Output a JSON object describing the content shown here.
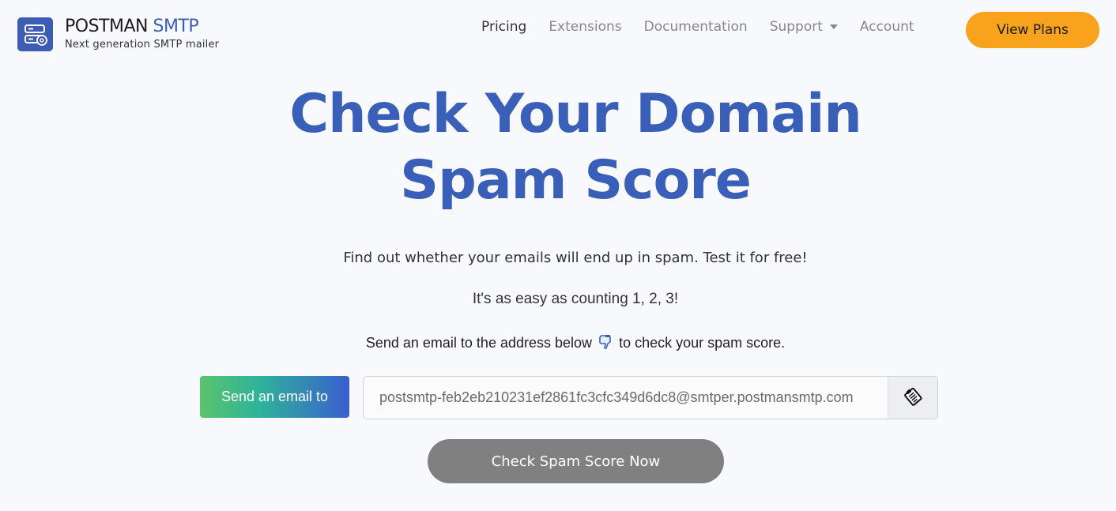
{
  "header": {
    "logo": {
      "title_main": "POSTMAN",
      "title_accent": "SMTP",
      "tagline": "Next generation SMTP mailer",
      "icon": "server-mail-icon"
    },
    "nav": [
      {
        "label": "Pricing",
        "active": true
      },
      {
        "label": "Extensions",
        "active": false
      },
      {
        "label": "Documentation",
        "active": false
      },
      {
        "label": "Support",
        "active": false,
        "dropdown": true
      },
      {
        "label": "Account",
        "active": false
      }
    ],
    "cta_label": "View Plans"
  },
  "hero": {
    "title_line1": "Check Your Domain",
    "title_line2": "Spam Score",
    "lead1": "Find out whether your emails will end up in spam. Test it for free!",
    "lead2": "It's as easy as counting 1, 2, 3!",
    "lead3_before": "Send an email to the address below",
    "lead3_after": "to check your spam score.",
    "lead3_icon": "pointing-down-icon"
  },
  "form": {
    "send_label": "Send an email to",
    "email_value": "postsmtp-feb2eb210231ef2861fc3cfc349d6dc8@smtper.postmansmtp.com",
    "copy_icon": "clipboard-icon",
    "check_button_label": "Check Spam Score Now"
  },
  "colors": {
    "brand_blue": "#3a5fb8",
    "cta_orange": "#f9a21b",
    "check_button_gray": "#808080",
    "background": "#f8f9fc"
  }
}
